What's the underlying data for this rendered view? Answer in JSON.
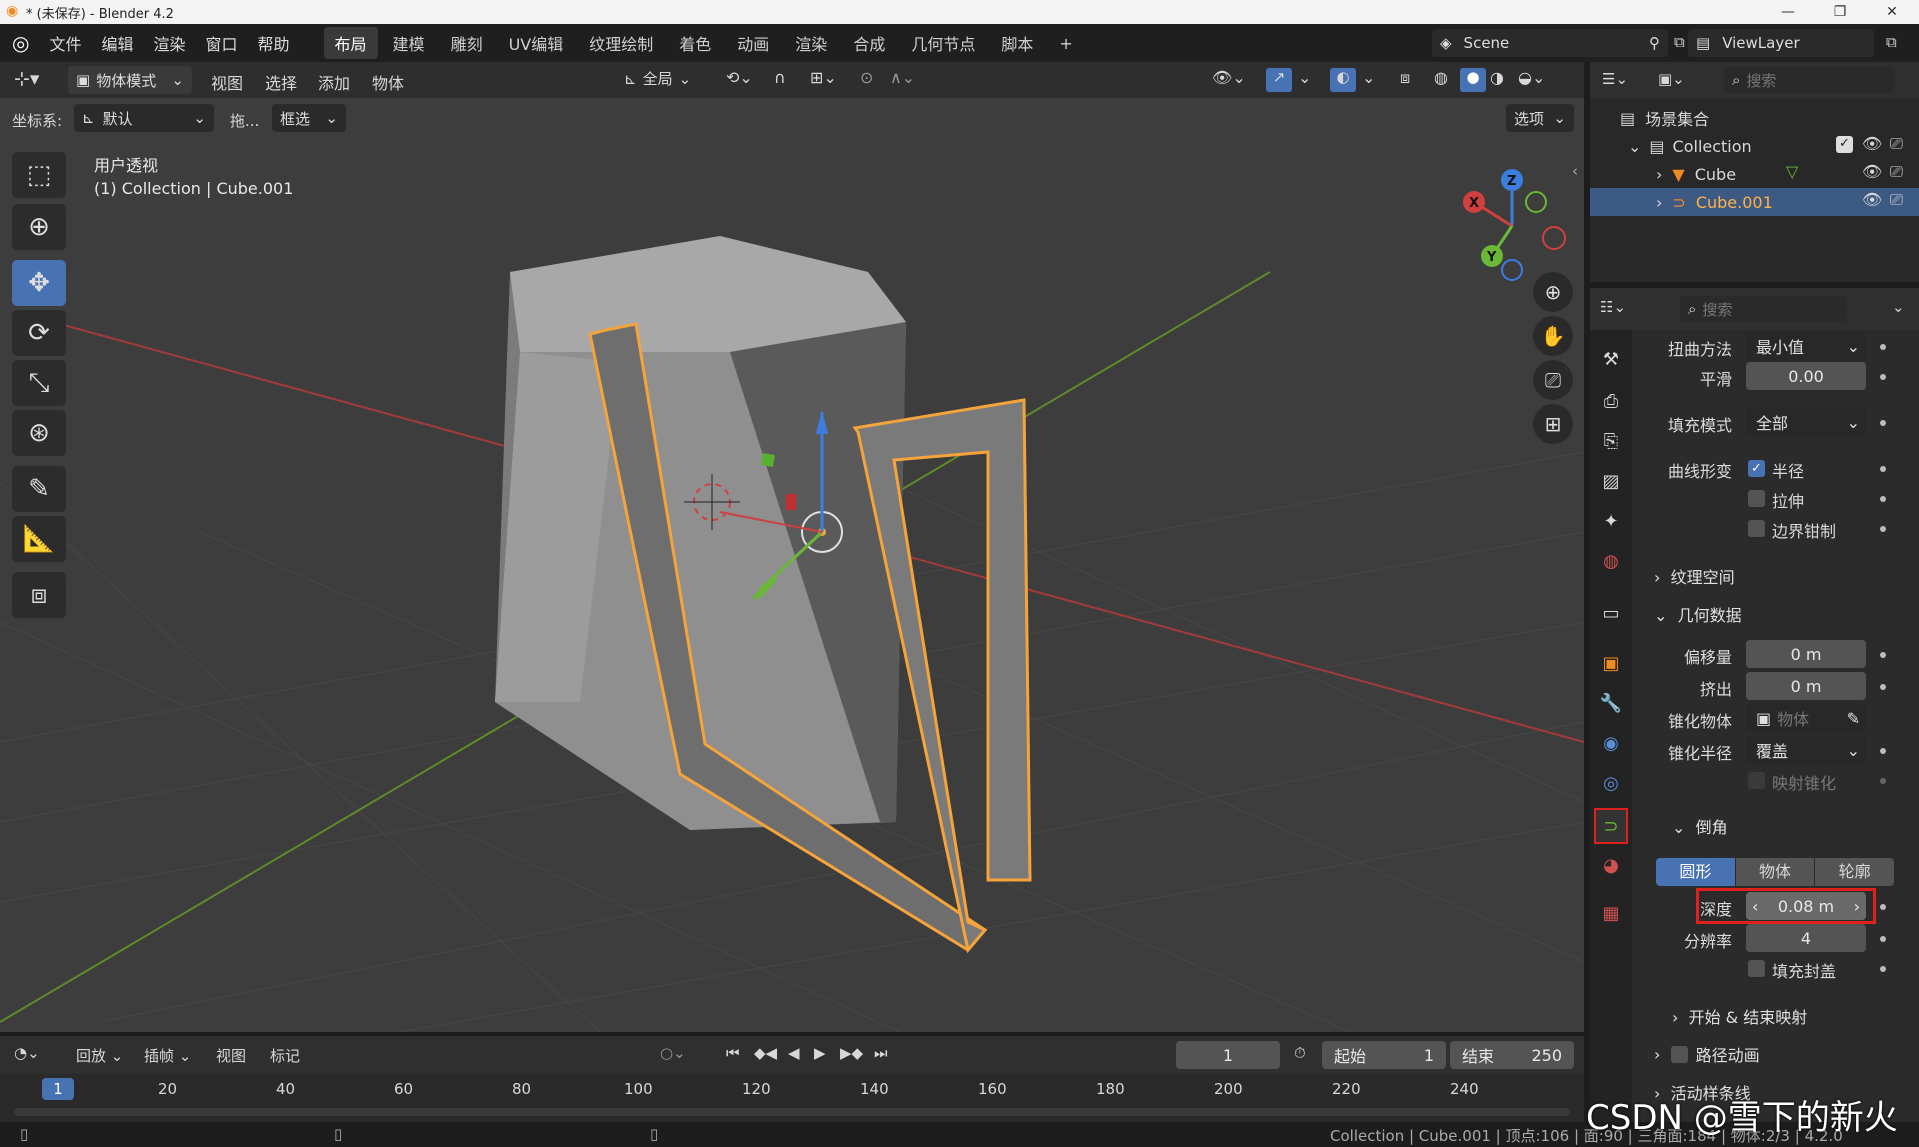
{
  "window": {
    "title": "* (未保存) - Blender 4.2"
  },
  "menu": [
    "文件",
    "编辑",
    "渲染",
    "窗口",
    "帮助"
  ],
  "workspaces": [
    "布局",
    "建模",
    "雕刻",
    "UV编辑",
    "纹理绘制",
    "着色",
    "动画",
    "渲染",
    "合成",
    "几何节点",
    "脚本"
  ],
  "scene": {
    "name": "Scene",
    "viewlayer": "ViewLayer"
  },
  "viewport_header": {
    "mode": "物体模式",
    "view": "视图",
    "select": "选择",
    "add": "添加",
    "object": "物体",
    "transform_orientation": "全局",
    "coord_label": "坐标系:",
    "coord_value": "默认",
    "drag_label": "拖...",
    "drag_value": "框选",
    "options": "选项"
  },
  "viewport_info": {
    "line1": "用户透视",
    "line2": "(1) Collection | Cube.001"
  },
  "outliner": {
    "search_placeholder": "搜索",
    "root": "场景集合",
    "items": [
      {
        "name": "Collection"
      },
      {
        "name": "Cube"
      },
      {
        "name": "Cube.001"
      }
    ]
  },
  "properties": {
    "search_placeholder": "搜索",
    "twist_method_label": "扭曲方法",
    "twist_method": "最小值",
    "smooth_label": "平滑",
    "smooth": "0.00",
    "fill_mode_label": "填充模式",
    "fill_mode": "全部",
    "curve_deform_label": "曲线形变",
    "cb_radius": "半径",
    "cb_stretch": "拉伸",
    "cb_clamp": "边界钳制",
    "texture_space": "纹理空间",
    "geometry": "几何数据",
    "offset_label": "偏移量",
    "offset": "0 m",
    "extrude_label": "挤出",
    "extrude": "0 m",
    "taper_obj_label": "锥化物体",
    "taper_obj_placeholder": "物体",
    "taper_radius_label": "锥化半径",
    "taper_radius": "覆盖",
    "map_taper": "映射锥化",
    "bevel": "倒角",
    "bevel_tabs": [
      "圆形",
      "物体",
      "轮廓"
    ],
    "depth_label": "深度",
    "depth": "0.08 m",
    "resolution_label": "分辨率",
    "resolution": "4",
    "fill_caps": "填充封盖",
    "start_end": "开始 & 结束映射",
    "path_anim": "路径动画",
    "active_spline": "活动样条线"
  },
  "timeline": {
    "playback": "回放",
    "keying": "插帧",
    "view": "视图",
    "marker": "标记",
    "current_frame": "1",
    "start_label": "起始",
    "start": "1",
    "end_label": "结束",
    "end": "250",
    "ruler": [
      "20",
      "40",
      "60",
      "80",
      "100",
      "120",
      "140",
      "160",
      "180",
      "200",
      "220",
      "240"
    ],
    "playhead": "1"
  },
  "statusbar": {
    "text": "Collection | Cube.001 | 顶点:106 | 面:90 | 三角面:184 | 物体:2/3 | 4.2.0"
  },
  "watermark": "CSDN @雪下的新火",
  "colors": {
    "accent": "#4772b3",
    "selection": "#f5a33b",
    "highlight_box": "#e0201c"
  }
}
